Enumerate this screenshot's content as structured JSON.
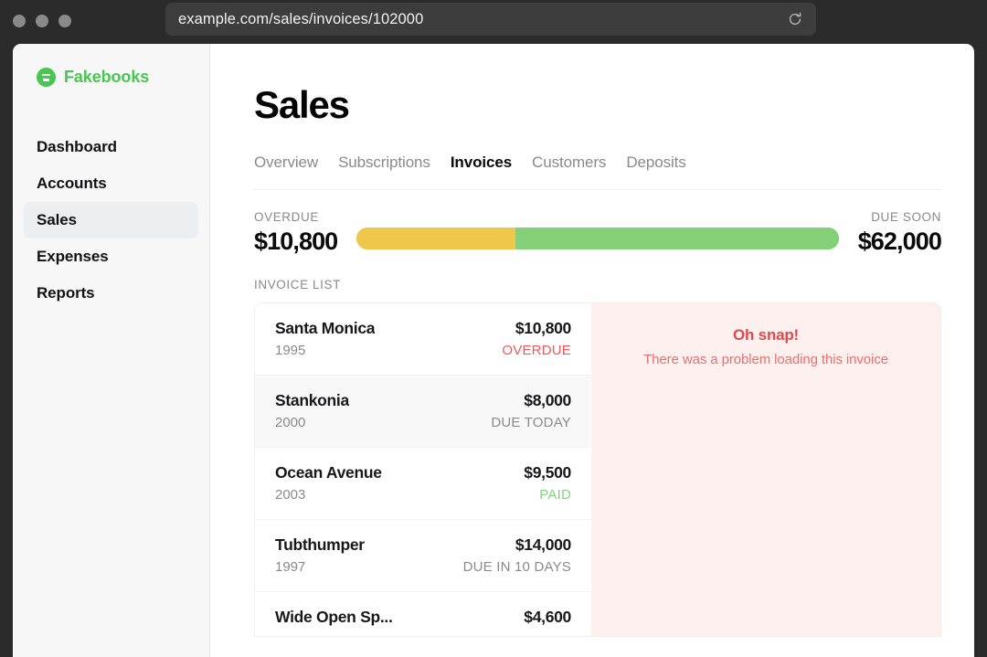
{
  "browser": {
    "url": "example.com/sales/invoices/102000",
    "reload_icon": "reload-icon",
    "traffic_lights": [
      "close",
      "minimize",
      "maximize"
    ]
  },
  "sidebar": {
    "brand": {
      "name": "Fakebooks",
      "logo_icon": "fakebooks-logo-icon",
      "color": "#4bc552"
    },
    "items": [
      {
        "label": "Dashboard",
        "active": false
      },
      {
        "label": "Accounts",
        "active": false
      },
      {
        "label": "Sales",
        "active": true
      },
      {
        "label": "Expenses",
        "active": false
      },
      {
        "label": "Reports",
        "active": false
      }
    ]
  },
  "main": {
    "title": "Sales",
    "tabs": [
      {
        "label": "Overview",
        "active": false
      },
      {
        "label": "Subscriptions",
        "active": false
      },
      {
        "label": "Invoices",
        "active": true
      },
      {
        "label": "Customers",
        "active": false
      },
      {
        "label": "Deposits",
        "active": false
      }
    ],
    "totals": {
      "overdue_label": "OVERDUE",
      "overdue_amount": "$10,800",
      "due_soon_label": "DUE SOON",
      "due_soon_amount": "$62,000",
      "overdue_percent": 33,
      "overdue_color": "#efc74a",
      "due_soon_color": "#86cf79"
    },
    "list_label": "INVOICE LIST",
    "invoices": [
      {
        "name": "Santa Monica",
        "year": "1995",
        "amount": "$10,800",
        "status": "OVERDUE",
        "status_type": "overdue",
        "selected": true
      },
      {
        "name": "Stankonia",
        "year": "2000",
        "amount": "$8,000",
        "status": "DUE TODAY",
        "status_type": "due",
        "selected": false
      },
      {
        "name": "Ocean Avenue",
        "year": "2003",
        "amount": "$9,500",
        "status": "PAID",
        "status_type": "paid",
        "selected": false
      },
      {
        "name": "Tubthumper",
        "year": "1997",
        "amount": "$14,000",
        "status": "DUE IN 10 DAYS",
        "status_type": "due",
        "selected": false
      },
      {
        "name": "Wide Open Sp...",
        "year": "",
        "amount": "$4,600",
        "status": "",
        "status_type": "due",
        "selected": false
      }
    ],
    "error": {
      "title": "Oh snap!",
      "message": "There was a problem loading this invoice",
      "background": "#fdf0ee",
      "title_color": "#e04a4f"
    }
  }
}
